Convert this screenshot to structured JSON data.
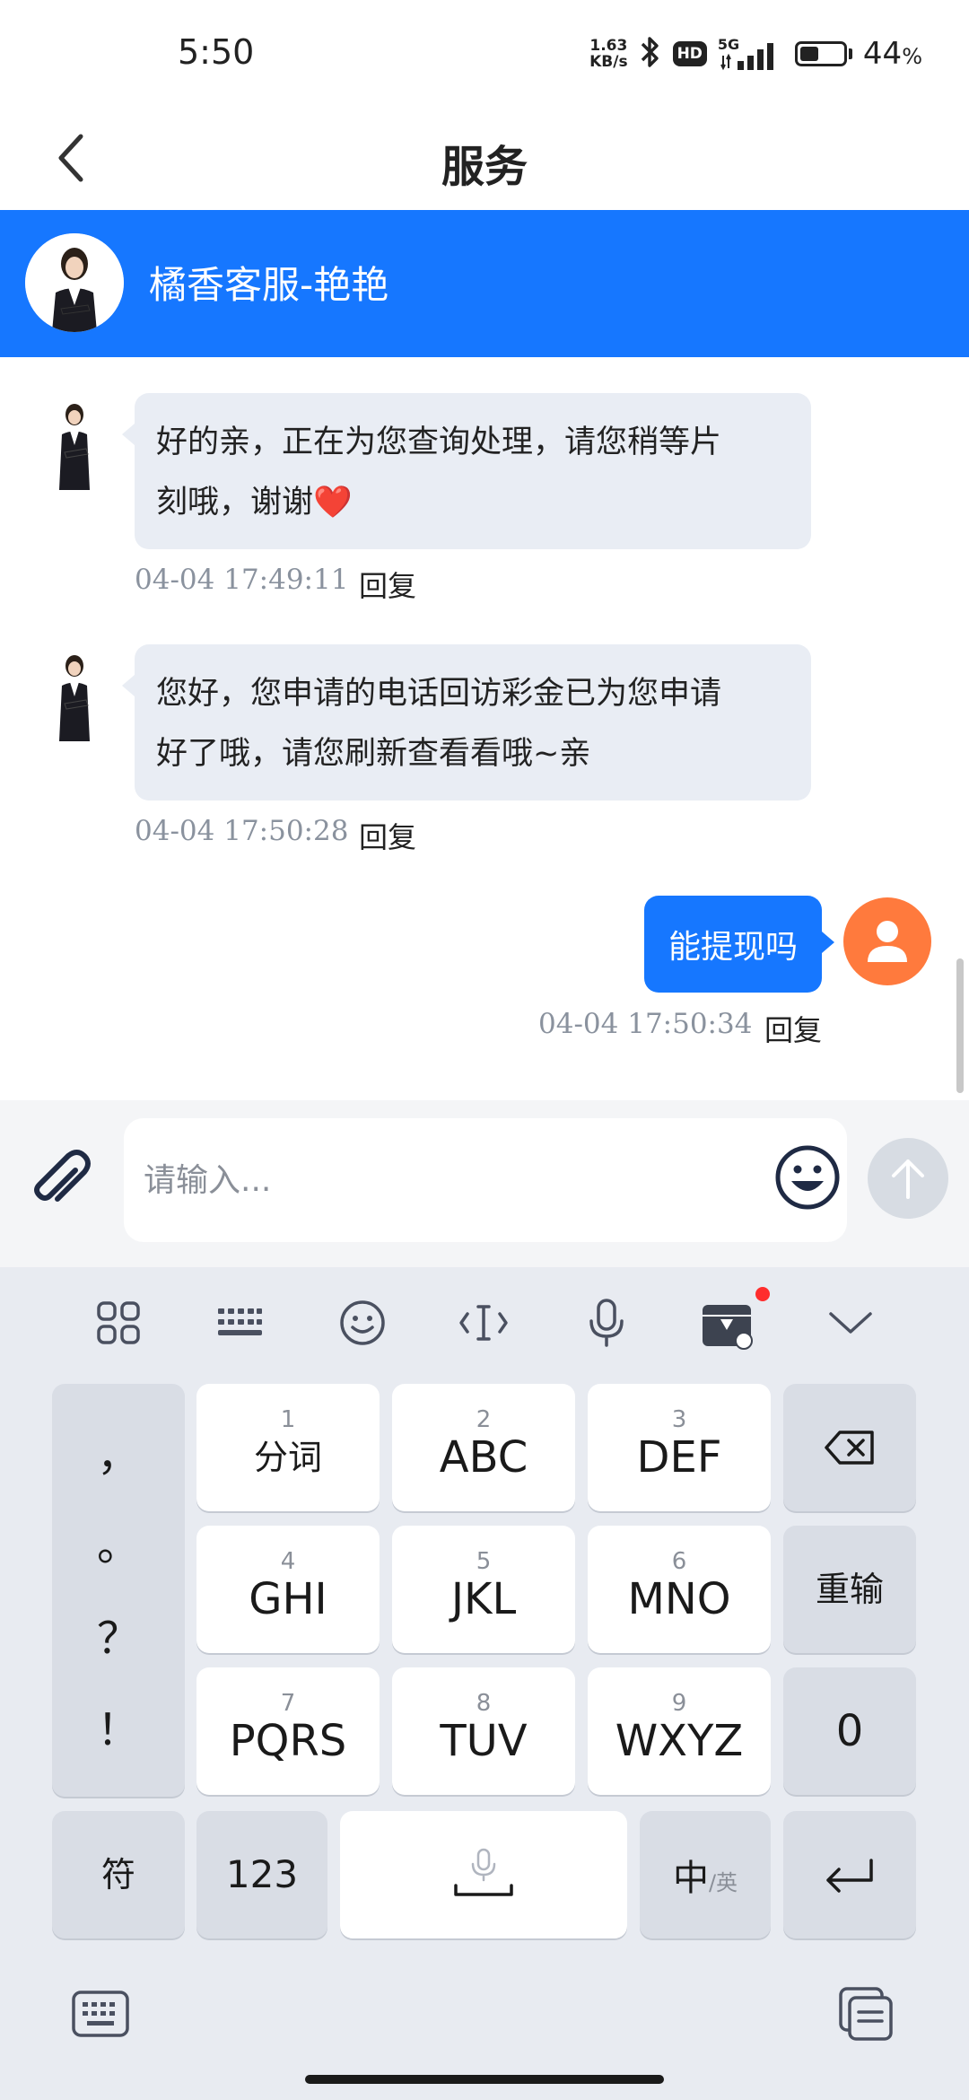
{
  "status_bar": {
    "time": "5:50",
    "net_speed_value": "1.63",
    "net_speed_unit": "KB/s",
    "hd_label": "HD",
    "network": "5G",
    "battery_percent": "44",
    "battery_percent_sign": "%",
    "battery_level": 0.44,
    "icons": [
      "bluetooth-icon",
      "hd-icon",
      "signal-icon",
      "battery-icon"
    ]
  },
  "header": {
    "title": "服务",
    "back_icon": "chevron-left-icon"
  },
  "agent": {
    "name": "橘香客服-艳艳",
    "banner_color": "#1677ff"
  },
  "messages": [
    {
      "direction": "incoming",
      "lines": [
        "好的亲，正在为您查询处理，请您稍等片",
        "刻哦，谢谢❤️"
      ],
      "time": "04-04 17:49:11",
      "reply_label": "回复"
    },
    {
      "direction": "incoming",
      "lines": [
        "您好，您申请的电话回访彩金已为您申请",
        "好了哦，请您刷新查看看哦~亲"
      ],
      "time": "04-04 17:50:28",
      "reply_label": "回复"
    },
    {
      "direction": "outgoing",
      "lines": [
        "能提现吗"
      ],
      "time": "04-04 17:50:34",
      "reply_label": "回复"
    }
  ],
  "input": {
    "placeholder": "请输入...",
    "value": ""
  },
  "keyboard": {
    "toolbar_icons": [
      "grid-icon",
      "keyboard-layout-icon",
      "emoji-icon",
      "cursor-icon",
      "microphone-icon",
      "toolbox-icon",
      "collapse-icon"
    ],
    "punctuation": [
      "，",
      "。",
      "？",
      "！"
    ],
    "keys": [
      {
        "num": "1",
        "label": "分词"
      },
      {
        "num": "2",
        "label": "ABC"
      },
      {
        "num": "3",
        "label": "DEF"
      },
      {
        "num": "4",
        "label": "GHI"
      },
      {
        "num": "5",
        "label": "JKL"
      },
      {
        "num": "6",
        "label": "MNO"
      },
      {
        "num": "7",
        "label": "PQRS"
      },
      {
        "num": "8",
        "label": "TUV"
      },
      {
        "num": "9",
        "label": "WXYZ"
      }
    ],
    "reenter_label": "重输",
    "zero_label": "0",
    "symbol_label": "符",
    "numbers_label": "123",
    "lang_main": "中",
    "lang_alt": "/英"
  },
  "colors": {
    "accent": "#1677ff",
    "incoming_bubble": "#e9edf4",
    "user_avatar": "#ff7a3d"
  }
}
